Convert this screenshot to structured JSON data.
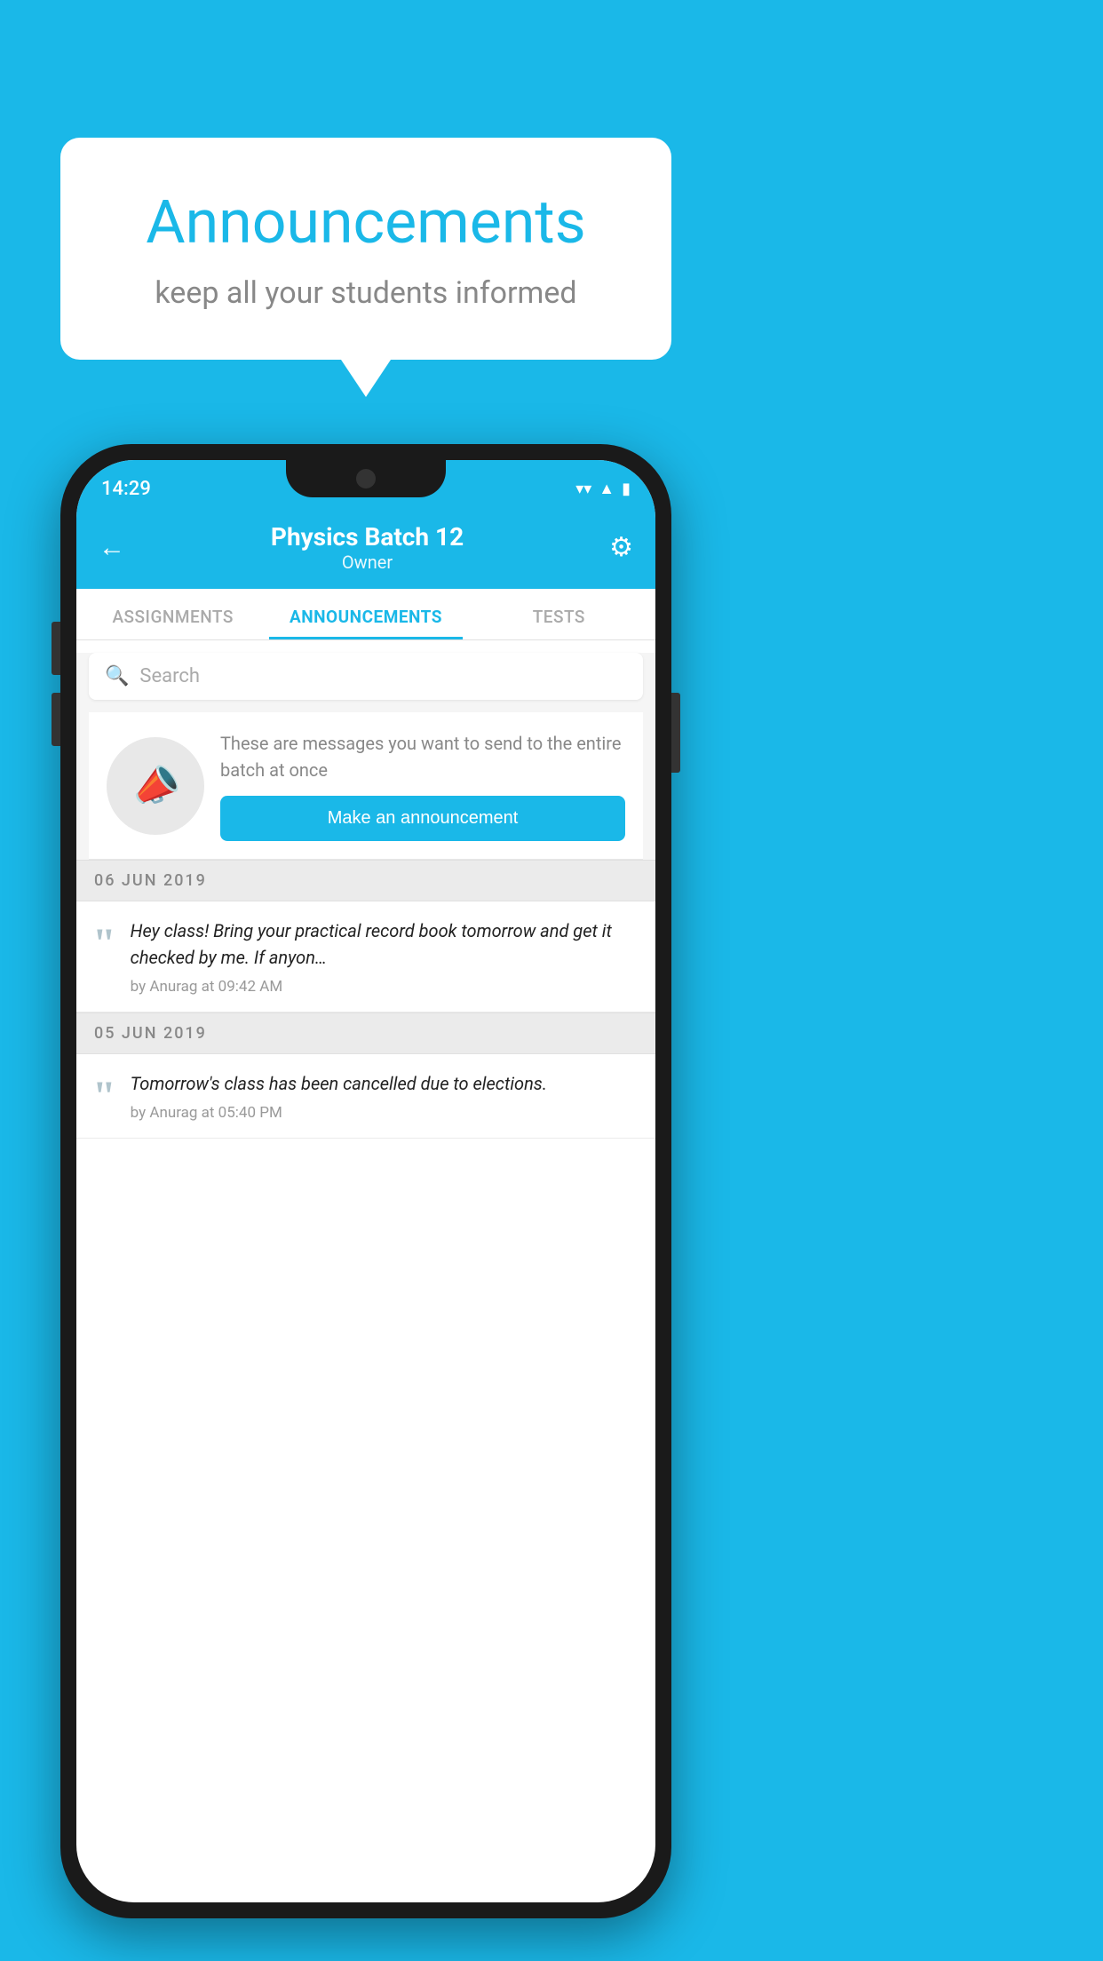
{
  "background_color": "#1ab8e8",
  "speech_bubble": {
    "title": "Announcements",
    "subtitle": "keep all your students informed"
  },
  "phone": {
    "status_bar": {
      "time": "14:29",
      "wifi": "▾",
      "signal": "▲",
      "battery": "▮"
    },
    "header": {
      "back_label": "←",
      "title": "Physics Batch 12",
      "subtitle": "Owner",
      "gear_label": "⚙"
    },
    "tabs": [
      {
        "label": "ASSIGNMENTS",
        "active": false
      },
      {
        "label": "ANNOUNCEMENTS",
        "active": true
      },
      {
        "label": "TESTS",
        "active": false
      }
    ],
    "search": {
      "placeholder": "Search",
      "icon": "🔍"
    },
    "announcement_prompt": {
      "description": "These are messages you want to send to the entire batch at once",
      "button_label": "Make an announcement"
    },
    "announcements": [
      {
        "date": "06  JUN  2019",
        "items": [
          {
            "text": "Hey class! Bring your practical record book tomorrow and get it checked by me. If anyon…",
            "meta": "by Anurag at 09:42 AM"
          }
        ]
      },
      {
        "date": "05  JUN  2019",
        "items": [
          {
            "text": "Tomorrow's class has been cancelled due to elections.",
            "meta": "by Anurag at 05:40 PM"
          }
        ]
      }
    ]
  }
}
